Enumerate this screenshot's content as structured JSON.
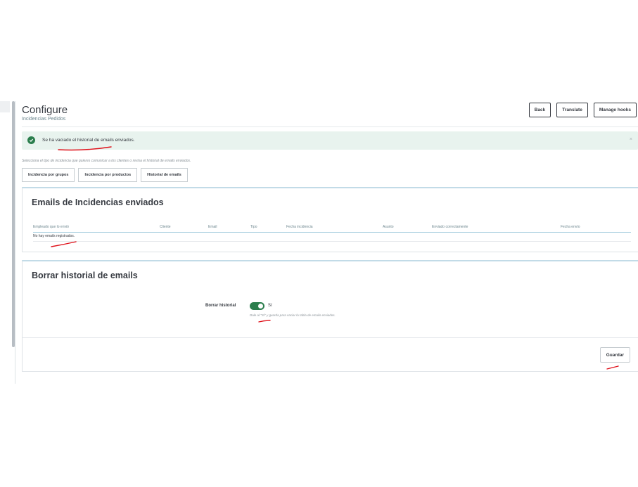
{
  "header": {
    "title": "Configure",
    "subtitle": "Incidencias Pedidos",
    "toolbar": {
      "back": "Back",
      "translate": "Translate",
      "manage_hooks": "Manage hooks"
    }
  },
  "alert": {
    "type": "success",
    "icon": "check-circle-icon",
    "text": "Se ha vaciado el historial de emails enviados.",
    "close": "×"
  },
  "hint": "Selecciona el tipo de incidencia que quieres comunicar a los clientes o revisa el historial de emails enviados.",
  "tabs": [
    {
      "label": "Incidencia por grupos"
    },
    {
      "label": "Incidencia por productos"
    },
    {
      "label": "Historial de emails"
    }
  ],
  "emails_panel": {
    "title": "Emails de Incidencias enviados",
    "columns": [
      "Empleado que lo envió",
      "Cliente",
      "Email",
      "Tipo",
      "Fecha incidencia",
      "Asunto",
      "Enviado correctamente",
      "Fecha envío"
    ],
    "empty_message": "No hay emails registrados."
  },
  "clear_panel": {
    "title": "Borrar historial de emails",
    "field_label": "Borrar historial",
    "switch_value": "Sí",
    "switch_on": true,
    "help": "Dale al \"Sí\" y guarda para vaciar la tabla de emails enviados.",
    "save_label": "Guardar"
  },
  "colors": {
    "success": "#2b7e4d",
    "alert_bg": "#e8f3ee",
    "annotation": "#e0121b"
  }
}
